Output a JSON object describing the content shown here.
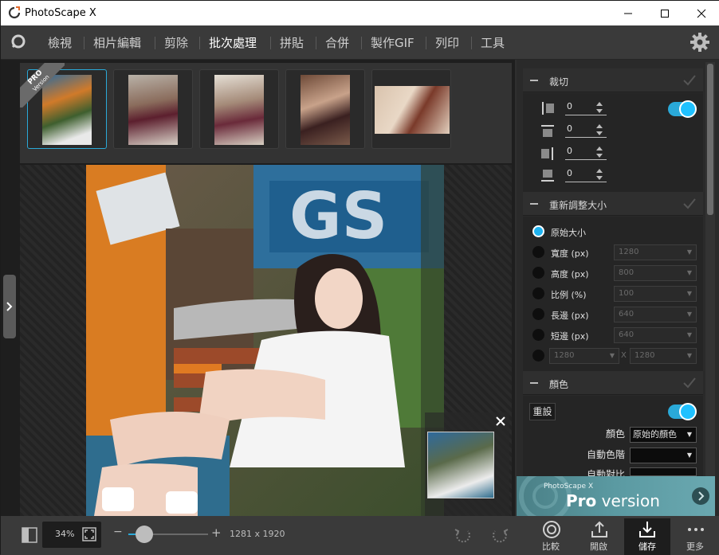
{
  "window": {
    "title": "PhotoScape X"
  },
  "menu": {
    "items": [
      "檢視",
      "相片編輯",
      "剪除",
      "批次處理",
      "拼貼",
      "合併",
      "製作GIF",
      "列印",
      "工具"
    ],
    "active": "批次處理"
  },
  "thumbnails": {
    "badge_line1": "PRO",
    "badge_line2": "Version",
    "count": 5,
    "selected_index": 0
  },
  "crop_section": {
    "title": "裁切",
    "values": [
      "0",
      "0",
      "0",
      "0"
    ],
    "enabled": true
  },
  "resize_section": {
    "title": "重新調整大小",
    "options": [
      {
        "label": "原始大小",
        "checked": true,
        "value": ""
      },
      {
        "label": "寬度 (px)",
        "checked": false,
        "value": "1280"
      },
      {
        "label": "高度 (px)",
        "checked": false,
        "value": "800"
      },
      {
        "label": "比例 (%)",
        "checked": false,
        "value": "100"
      },
      {
        "label": "長邊 (px)",
        "checked": false,
        "value": "640"
      },
      {
        "label": "短邊 (px)",
        "checked": false,
        "value": "640"
      }
    ],
    "custom_width": "1280",
    "custom_height": "1280",
    "custom_sep": "X"
  },
  "color_section": {
    "title": "顏色",
    "reset_label": "重設",
    "enabled": true,
    "color_label": "顏色",
    "color_value": "原始的顏色",
    "auto_levels_label": "自動色階",
    "auto_levels_value": "",
    "auto_contrast_label": "自動對比"
  },
  "pro_banner": {
    "small_text": "PhotoScape X",
    "pro_text": "Pro",
    "version_text": " version"
  },
  "bottom": {
    "zoom": "34%",
    "zoom_min": "−",
    "zoom_plus": "+",
    "image_size": "1281 x 1920",
    "compare_label": "比較",
    "open_label": "開啟",
    "save_label": "儲存",
    "more_label": "更多"
  },
  "colors": {
    "accent": "#2aa9d8",
    "background": "#2f2f2f"
  }
}
